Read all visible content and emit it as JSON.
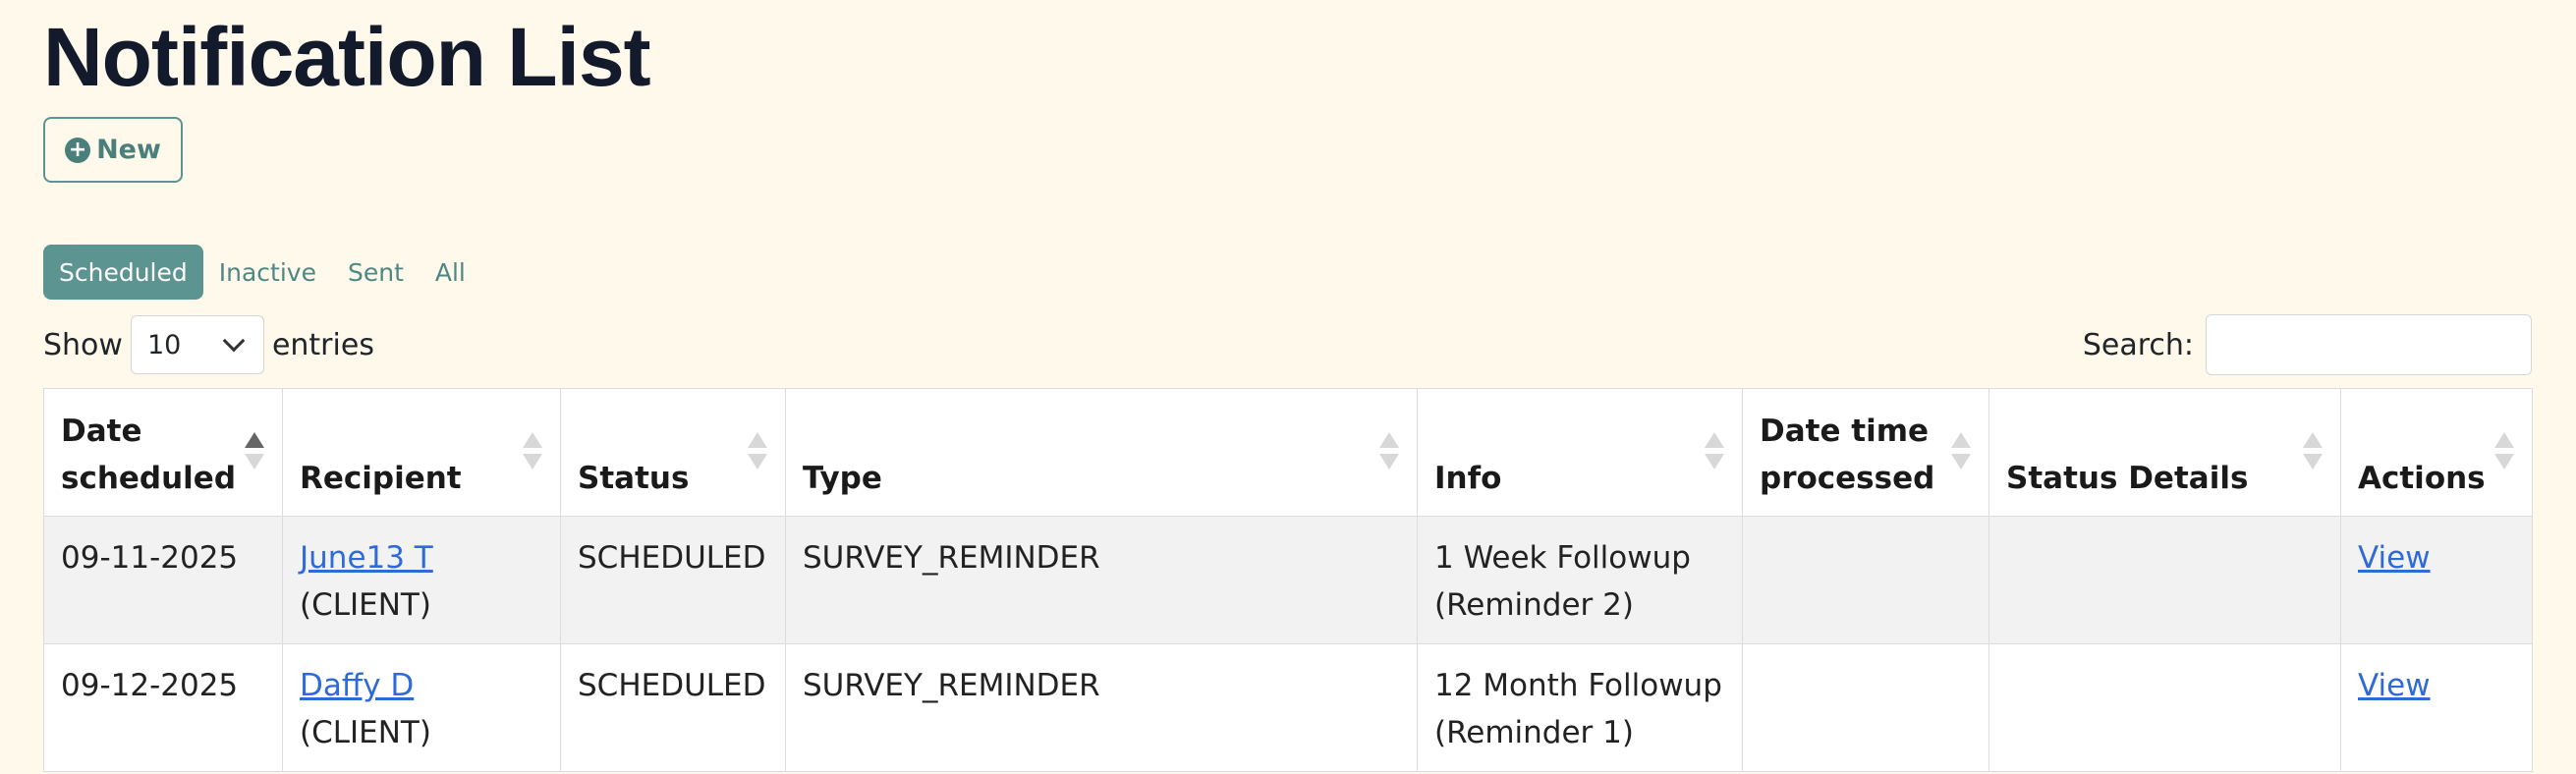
{
  "page_title": "Notification List",
  "new_button": {
    "label": "New"
  },
  "filters": [
    {
      "label": "Scheduled",
      "active": true
    },
    {
      "label": "Inactive",
      "active": false
    },
    {
      "label": "Sent",
      "active": false
    },
    {
      "label": "All",
      "active": false
    }
  ],
  "length_control": {
    "prefix": "Show",
    "value": "10",
    "suffix": "entries"
  },
  "search": {
    "label": "Search:",
    "value": ""
  },
  "table": {
    "columns": [
      "Date scheduled",
      "Recipient",
      "Status",
      "Type",
      "Info",
      "Date time processed",
      "Status Details",
      "Actions"
    ],
    "sorted_column": "Date scheduled",
    "rows": [
      {
        "date_scheduled": "09-11-2025",
        "recipient_name": "June13 T",
        "recipient_role": "(CLIENT)",
        "status": "SCHEDULED",
        "type": "SURVEY_REMINDER",
        "info_line1": "1 Week Followup",
        "info_line2": "(Reminder 2)",
        "date_time_processed": "",
        "status_details": "",
        "action": "View"
      },
      {
        "date_scheduled": "09-12-2025",
        "recipient_name": "Daffy D",
        "recipient_role": "(CLIENT)",
        "status": "SCHEDULED",
        "type": "SURVEY_REMINDER",
        "info_line1": "12 Month Followup",
        "info_line2": "(Reminder 1)",
        "date_time_processed": "",
        "status_details": "",
        "action": "View"
      }
    ]
  },
  "colors": {
    "background": "#fef9ea",
    "accent": "#5b9491",
    "link": "#2f6bd8",
    "title": "#121a2c"
  }
}
